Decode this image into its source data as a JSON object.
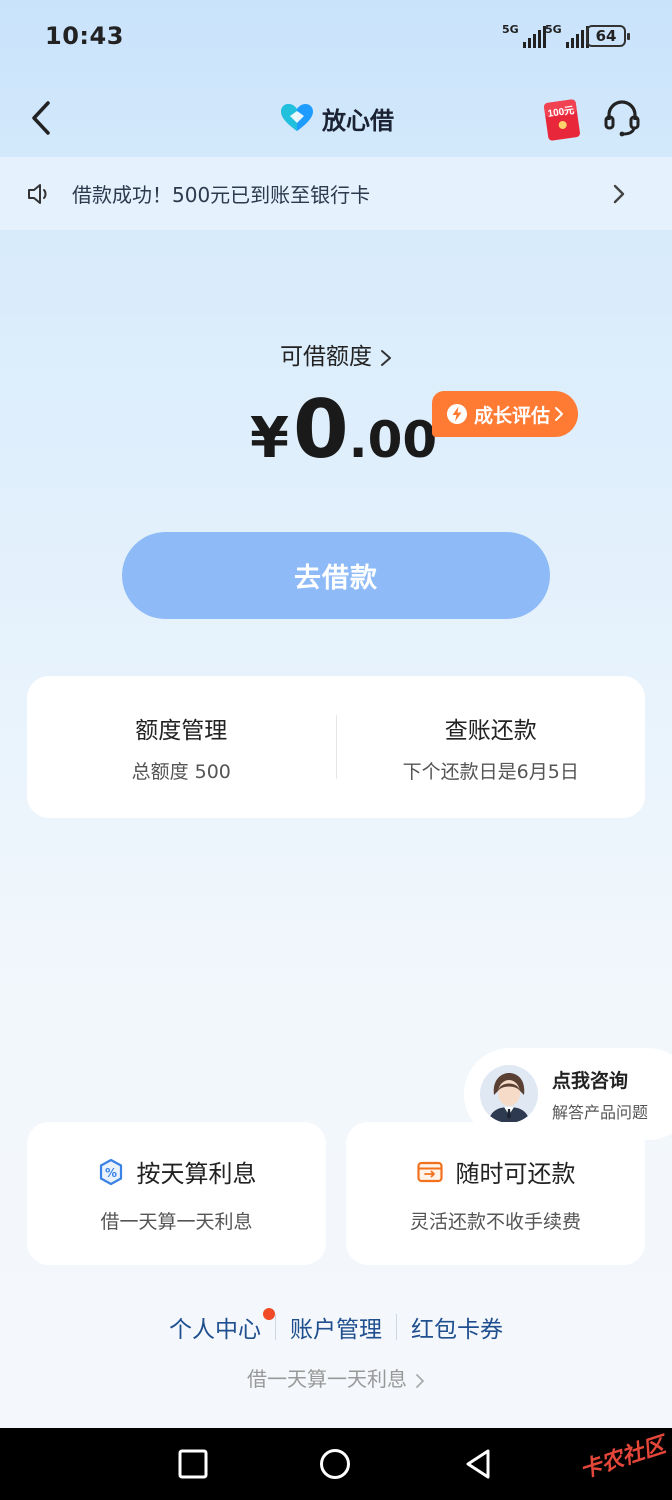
{
  "status_bar": {
    "time": "10:43",
    "signal1_label": "5G",
    "signal2_label": "5G",
    "battery": "64"
  },
  "header": {
    "title": "放心借",
    "coupon_text": "100元",
    "brand_color": "#1e9bff"
  },
  "notice": {
    "text": "借款成功！500元已到账至银行卡"
  },
  "amount_section": {
    "label": "可借额度",
    "currency": "¥",
    "integer_part": "0",
    "decimal_part": ".00",
    "growth_badge": "成长评估"
  },
  "borrow_button": {
    "label": "去借款",
    "color": "#8ebaf8"
  },
  "management": {
    "limit": {
      "title": "额度管理",
      "subtitle": "总额度 500"
    },
    "repay": {
      "title": "查账还款",
      "subtitle": "下个还款日是6月5日"
    }
  },
  "consult": {
    "title": "点我咨询",
    "subtitle": "解答产品问题"
  },
  "features": [
    {
      "title": "按天算利息",
      "subtitle": "借一天算一天利息",
      "icon": "percent-shield-icon"
    },
    {
      "title": "随时可还款",
      "subtitle": "灵活还款不收手续费",
      "icon": "wallet-card-icon"
    }
  ],
  "bottom_links": {
    "personal": "个人中心",
    "account": "账户管理",
    "coupons": "红包卡券",
    "note": "借一天算一天利息"
  },
  "watermark": "卡农社区",
  "colors": {
    "accent_orange": "#ff7a33",
    "link_blue": "#1f4f8f",
    "red_dot": "#f04a26"
  }
}
